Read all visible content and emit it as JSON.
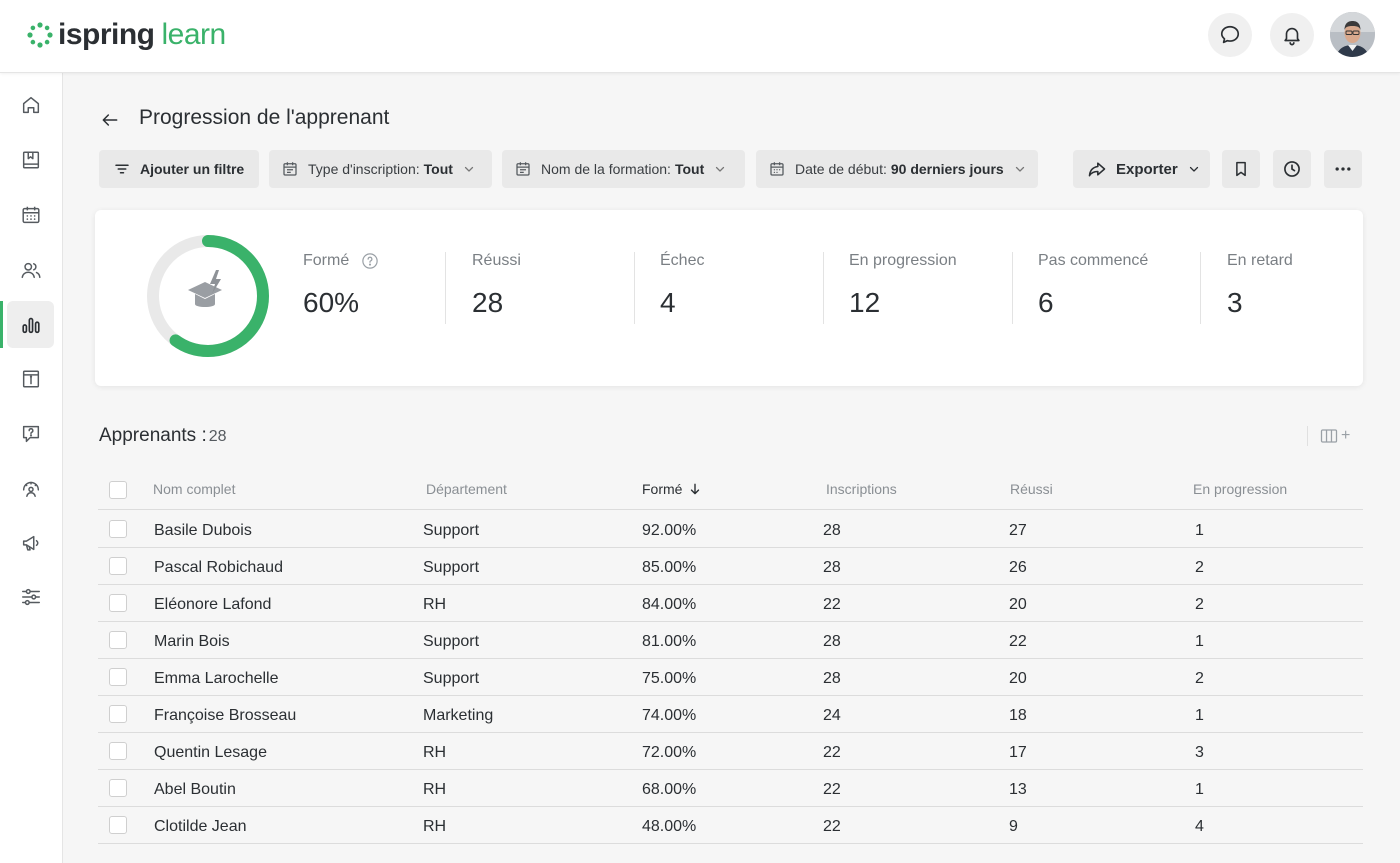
{
  "header": {
    "brand_part1": "ispring",
    "brand_part2": "learn",
    "brand_color": "#3ab26a"
  },
  "sidebar": {
    "items": [
      {
        "icon": "home-icon",
        "active": false
      },
      {
        "icon": "book-icon",
        "active": false
      },
      {
        "icon": "calendar-icon",
        "active": false
      },
      {
        "icon": "users-icon",
        "active": false
      },
      {
        "icon": "reports-icon",
        "active": true
      },
      {
        "icon": "info-archive-icon",
        "active": false
      },
      {
        "icon": "question-chat-icon",
        "active": false
      },
      {
        "icon": "gauge-person-icon",
        "active": false
      },
      {
        "icon": "megaphone-icon",
        "active": false
      },
      {
        "icon": "settings-sliders-icon",
        "active": false
      }
    ]
  },
  "page": {
    "title": "Progression de l'apprenant"
  },
  "filters": {
    "add_filter": "Ajouter un filtre",
    "enrollment_label": "Type d'inscription:",
    "enrollment_value": "Tout",
    "course_label": "Nom de la formation:",
    "course_value": "Tout",
    "start_label": "Date de début:",
    "start_value": "90 derniers jours",
    "export": "Exporter"
  },
  "stats": {
    "trained_label": "Formé",
    "trained_value": "60%",
    "trained_fraction": 0.6,
    "passed_label": "Réussi",
    "passed_value": "28",
    "failed_label": "Échec",
    "failed_value": "4",
    "in_progress_label": "En progression",
    "in_progress_value": "12",
    "not_started_label": "Pas commencé",
    "not_started_value": "6",
    "overdue_label": "En retard",
    "overdue_value": "3"
  },
  "learners": {
    "heading": "Apprenants :",
    "count": "28",
    "columns": {
      "name": "Nom complet",
      "department": "Département",
      "trained": "Formé",
      "enrollments": "Inscriptions",
      "passed": "Réussi",
      "in_progress": "En progression"
    },
    "rows": [
      {
        "name": "Basile Dubois",
        "department": "Support",
        "trained": "92.00%",
        "enrollments": "28",
        "passed": "27",
        "in_progress": "1"
      },
      {
        "name": "Pascal Robichaud",
        "department": "Support",
        "trained": "85.00%",
        "enrollments": "28",
        "passed": "26",
        "in_progress": "2"
      },
      {
        "name": "Eléonore Lafond",
        "department": "RH",
        "trained": "84.00%",
        "enrollments": "22",
        "passed": "20",
        "in_progress": "2"
      },
      {
        "name": "Marin Bois",
        "department": "Support",
        "trained": "81.00%",
        "enrollments": "28",
        "passed": "22",
        "in_progress": "1"
      },
      {
        "name": "Emma Larochelle",
        "department": "Support",
        "trained": "75.00%",
        "enrollments": "28",
        "passed": "20",
        "in_progress": "2"
      },
      {
        "name": "Françoise Brosseau",
        "department": "Marketing",
        "trained": "74.00%",
        "enrollments": "24",
        "passed": "18",
        "in_progress": "1"
      },
      {
        "name": "Quentin Lesage",
        "department": "RH",
        "trained": "72.00%",
        "enrollments": "22",
        "passed": "17",
        "in_progress": "3"
      },
      {
        "name": "Abel Boutin",
        "department": "RH",
        "trained": "68.00%",
        "enrollments": "22",
        "passed": "13",
        "in_progress": "1"
      },
      {
        "name": "Clotilde Jean",
        "department": "RH",
        "trained": "48.00%",
        "enrollments": "22",
        "passed": "9",
        "in_progress": "4"
      }
    ]
  }
}
